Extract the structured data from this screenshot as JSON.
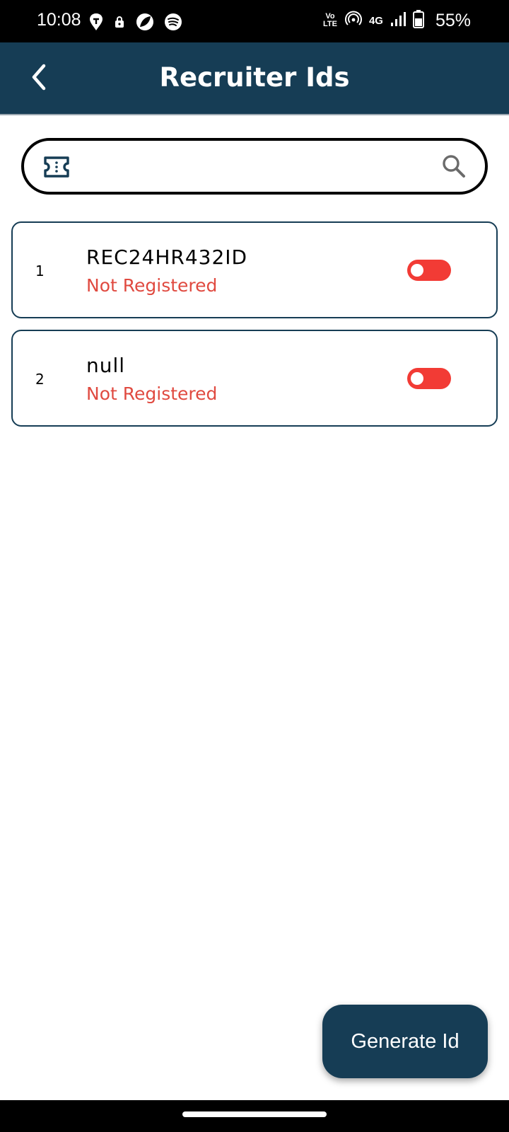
{
  "status_bar": {
    "time": "10:08",
    "network_label": "4G",
    "volte_label": "Vo LTE",
    "battery_percent": "55%",
    "left_icons": [
      "swiggy-icon",
      "notification-lock-icon",
      "app-leaf-icon",
      "spotify-icon"
    ],
    "right_icons": [
      "volte-icon",
      "hotspot-icon",
      "signal-icon",
      "battery-icon"
    ]
  },
  "app_bar": {
    "title": "Recruiter Ids",
    "back_icon": "chevron-left-icon",
    "background": "#163d55"
  },
  "search": {
    "value": "",
    "placeholder": "",
    "leading_icon": "ticket-icon",
    "trailing_icon": "search-icon"
  },
  "recruiters": [
    {
      "index": "1",
      "id": "REC24HR432ID",
      "status": "Not Registered",
      "enabled": false
    },
    {
      "index": "2",
      "id": "null",
      "status": "Not Registered",
      "enabled": false
    }
  ],
  "fab": {
    "label": "Generate Id"
  },
  "colors": {
    "primary": "#163d55",
    "status_text": "#e04a40",
    "toggle_off": "#f23b35"
  }
}
